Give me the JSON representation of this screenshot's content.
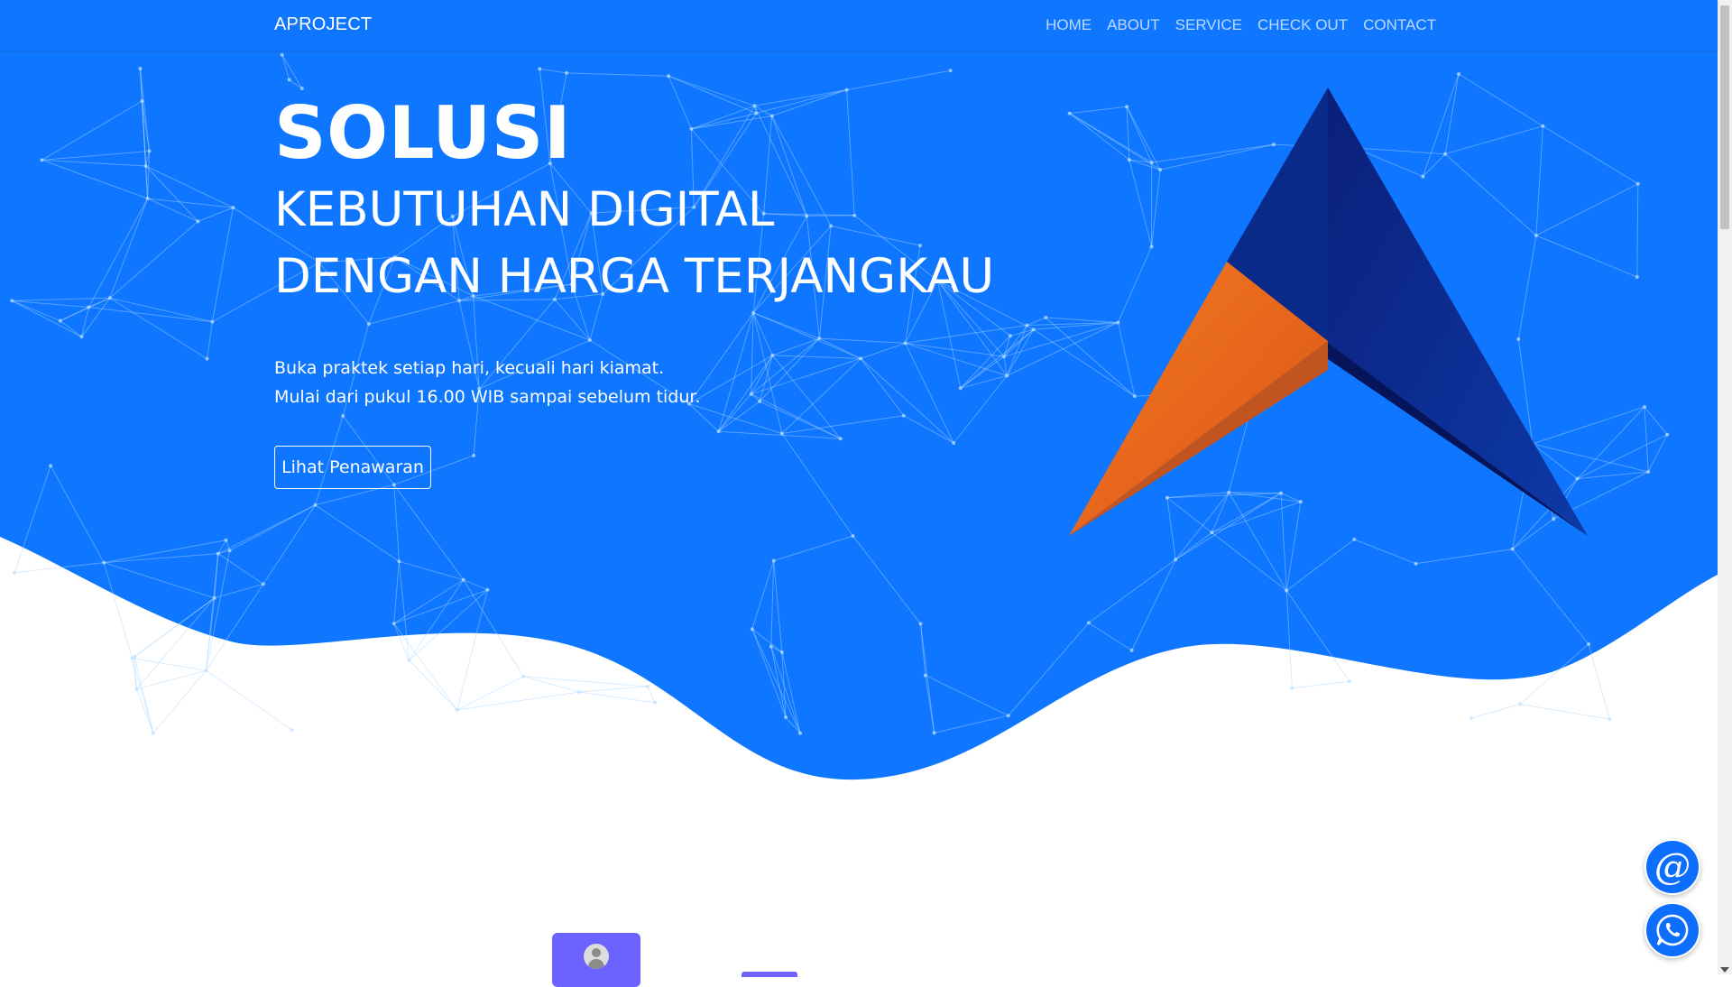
{
  "brand": "APROJECT",
  "nav": {
    "home": "HOME",
    "about": "ABOUT",
    "service": "SERVICE",
    "checkout": "CHECK OUT",
    "contact": "CONTACT"
  },
  "hero": {
    "title": "SOLUSI",
    "subtitle_line1": "KEBUTUHAN DIGITAL",
    "subtitle_line2": "DENGAN HARGA TERJANGKAU",
    "desc_line1": "Buka praktek setiap hari, kecuali hari kiamat.",
    "desc_line2": "Mulai dari pukul 16.00 WIB sampai sebelum tidur.",
    "cta": "Lihat Penawaran"
  },
  "floating": {
    "email_symbol": "@",
    "email_icon": "at-sign-icon",
    "whatsapp_icon": "whatsapp-icon"
  },
  "colors": {
    "hero_blue": "#0f76ff",
    "logo_dark_blue": "#0a2a8a",
    "logo_orange": "#f26a1b",
    "card_purple": "#6c63ff"
  }
}
